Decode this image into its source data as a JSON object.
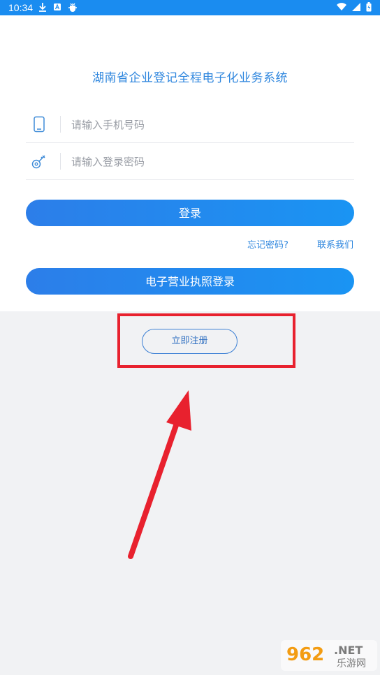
{
  "status_bar": {
    "time": "10:34",
    "left_icons": [
      "download-icon",
      "a-icon",
      "bug-icon"
    ],
    "right_icons": [
      "wifi-icon",
      "signal-icon",
      "battery-icon"
    ]
  },
  "login": {
    "title": "湖南省企业登记全程电子化业务系统",
    "phone": {
      "placeholder": "请输入手机号码",
      "value": "",
      "icon": "phone-icon"
    },
    "password": {
      "placeholder": "请输入登录密码",
      "value": "",
      "icon": "key-icon"
    },
    "login_button": "登录",
    "forgot_password": "忘记密码?",
    "contact_us": "联系我们",
    "license_login_button": "电子营业执照登录",
    "register_button": "立即注册"
  },
  "annotation": {
    "color": "#e8212e"
  },
  "watermark": {
    "number": "962",
    "suffix": ".NET",
    "site": "乐游网"
  },
  "colors": {
    "accent": "#2e86de",
    "status_bar": "#1a8cf0"
  }
}
